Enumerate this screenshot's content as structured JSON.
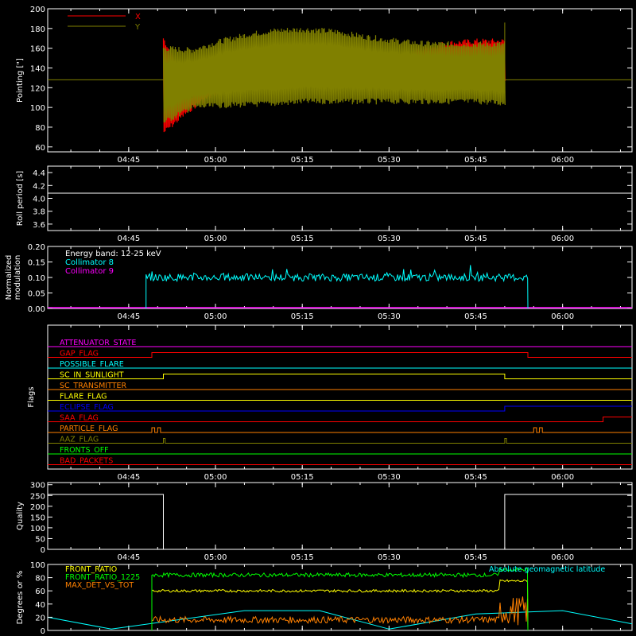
{
  "x_ticks": [
    "04:45",
    "05:00",
    "05:15",
    "05:30",
    "05:45",
    "06:00"
  ],
  "chart_data": [
    {
      "id": "pointing",
      "type": "line",
      "ylabel": "Pointing [\"]",
      "ylim": [
        55,
        200
      ],
      "yticks": [
        60,
        80,
        100,
        120,
        140,
        160,
        180,
        200
      ],
      "x_range": [
        "04:31",
        "06:12"
      ],
      "legend": [
        {
          "name": "X",
          "color": "#ff0000"
        },
        {
          "name": "Y",
          "color": "#808000"
        }
      ],
      "series": [
        {
          "name": "X",
          "color": "#ff0000",
          "x_start": "04:51",
          "x_end": "05:50",
          "upper": [
            170,
            112,
            127,
            133,
            136,
            138,
            140,
            145,
            150,
            158,
            165,
            167,
            167
          ],
          "lower": [
            75,
            100,
            118,
            122,
            124,
            126,
            128,
            130,
            132,
            130,
            128,
            127,
            127
          ]
        },
        {
          "name": "Y",
          "color": "#808000",
          "x_start": "04:51",
          "x_end": "05:50",
          "upper": [
            160,
            158,
            167,
            174,
            178,
            179,
            177,
            172,
            168,
            165,
            164,
            164,
            164
          ],
          "lower": [
            85,
            100,
            102,
            103,
            104,
            106,
            106,
            106,
            106,
            106,
            106,
            106,
            104
          ],
          "baseline": 128
        }
      ]
    },
    {
      "id": "roll",
      "type": "line",
      "ylabel": "Roll period [s]",
      "ylim": [
        3.5,
        4.5
      ],
      "yticks": [
        3.6,
        3.8,
        4.0,
        4.2,
        4.4
      ],
      "yticks_labels": [
        "3.6",
        "3.8",
        "4.0",
        "4.2",
        "4.4"
      ],
      "series": [
        {
          "name": "",
          "color": "#ffffff",
          "value": 4.08
        }
      ]
    },
    {
      "id": "modulation",
      "type": "line",
      "ylabel": "Normalized",
      "ylabel2": "modulation",
      "ylim": [
        0,
        0.2
      ],
      "yticks": [
        0,
        0.05,
        0.1,
        0.15,
        0.2
      ],
      "yticks_labels": [
        "0.00",
        "0.05",
        "0.10",
        "0.15",
        "0.20"
      ],
      "legend": [
        {
          "name": "Energy band: 12-25 keV",
          "color": "#ffffff"
        },
        {
          "name": "Collimator 8",
          "color": "#00ffff"
        },
        {
          "name": "Collimator 9",
          "color": "#ff00ff"
        }
      ],
      "series": [
        {
          "name": "Collimator 8",
          "color": "#00ffff",
          "x_start": "04:48",
          "x_end": "05:54",
          "mean": 0.1,
          "amp": 0.012
        },
        {
          "name": "Collimator 9",
          "color": "#ff00ff",
          "value": 0.0
        }
      ]
    },
    {
      "id": "flags",
      "type": "line",
      "ylabel": "Flags",
      "series": [
        {
          "name": "ATTENUATOR_STATE",
          "color": "#ff00ff",
          "steps": []
        },
        {
          "name": "GAP_FLAG",
          "color": "#ff0000",
          "steps": [
            [
              "04:49",
              1
            ],
            [
              "05:54",
              0
            ]
          ]
        },
        {
          "name": "POSSIBLE_FLARE",
          "color": "#00ffff",
          "steps": []
        },
        {
          "name": "SC_IN_SUNLIGHT",
          "color": "#ffff00",
          "steps": [
            [
              "04:51",
              1
            ],
            [
              "05:50",
              0
            ]
          ]
        },
        {
          "name": "SC_TRANSMITTER",
          "color": "#ff8000",
          "steps": []
        },
        {
          "name": "FLARE_FLAG",
          "color": "#ffff00",
          "steps": []
        },
        {
          "name": "ECLIPSE_FLAG",
          "color": "#0000ff",
          "steps": [
            [
              "04:51",
              0
            ],
            [
              "05:50",
              1
            ]
          ]
        },
        {
          "name": "SAA_FLAG",
          "color": "#ff0000",
          "steps": [
            [
              "04:48",
              0
            ],
            [
              "06:07",
              1
            ]
          ]
        },
        {
          "name": "PARTICLE_FLAG",
          "color": "#ff8000",
          "steps": [
            [
              "04:49",
              1
            ],
            [
              "04:49.5",
              0
            ],
            [
              "04:50",
              1
            ],
            [
              "04:50.5",
              0
            ],
            [
              "05:55",
              1
            ],
            [
              "05:55.5",
              0
            ],
            [
              "05:56",
              1
            ],
            [
              "05:56.5",
              0
            ]
          ]
        },
        {
          "name": "AAZ_FLAG",
          "color": "#808000",
          "steps": [
            [
              "04:51",
              1
            ],
            [
              "04:51.3",
              0
            ],
            [
              "05:50",
              1
            ],
            [
              "05:50.3",
              0
            ]
          ]
        },
        {
          "name": "FRONTS_OFF",
          "color": "#00ff00",
          "steps": []
        },
        {
          "name": "BAD_PACKETS",
          "color": "#ff0000",
          "steps": []
        }
      ]
    },
    {
      "id": "quality",
      "type": "line",
      "ylabel": "Quality",
      "ylim": [
        0,
        310
      ],
      "yticks": [
        0,
        50,
        100,
        150,
        200,
        250,
        300
      ],
      "series": [
        {
          "name": "",
          "color": "#ffffff",
          "steps": [
            [
              "04:31",
              255
            ],
            [
              "04:51",
              0
            ],
            [
              "05:50",
              255
            ]
          ]
        }
      ]
    },
    {
      "id": "ratios",
      "type": "line",
      "ylabel": "Degrees or %",
      "ylim": [
        0,
        100
      ],
      "yticks": [
        0,
        20,
        40,
        60,
        80,
        100
      ],
      "legend": [
        {
          "name": "FRONT_RATIO",
          "color": "#ffff00"
        },
        {
          "name": "FRONT_RATIO_1225",
          "color": "#00ff00"
        },
        {
          "name": "MAX_DET_VS_TOT",
          "color": "#ff8000"
        },
        {
          "name": "Absolute geomagnetic latitude",
          "color": "#00ffff"
        }
      ],
      "series": [
        {
          "name": "FRONT_RATIO",
          "color": "#ffff00",
          "x_start": "04:49",
          "x_end": "05:54",
          "mean": 60,
          "amp": 2
        },
        {
          "name": "FRONT_RATIO_1225",
          "color": "#00ff00",
          "x_start": "04:49",
          "x_end": "05:54",
          "mean": 84,
          "amp": 3
        },
        {
          "name": "MAX_DET_VS_TOT",
          "color": "#ff8000",
          "x_start": "04:49",
          "x_end": "05:54",
          "mean": 16,
          "amp": 5
        },
        {
          "name": "Absolute geomagnetic latitude",
          "color": "#00ffff",
          "points": [
            [
              "04:31",
              20
            ],
            [
              "04:42",
              2
            ],
            [
              "05:05",
              30
            ],
            [
              "05:18",
              30
            ],
            [
              "05:30",
              2
            ],
            [
              "05:45",
              25
            ],
            [
              "06:00",
              30
            ],
            [
              "06:12",
              10
            ]
          ]
        }
      ]
    }
  ]
}
